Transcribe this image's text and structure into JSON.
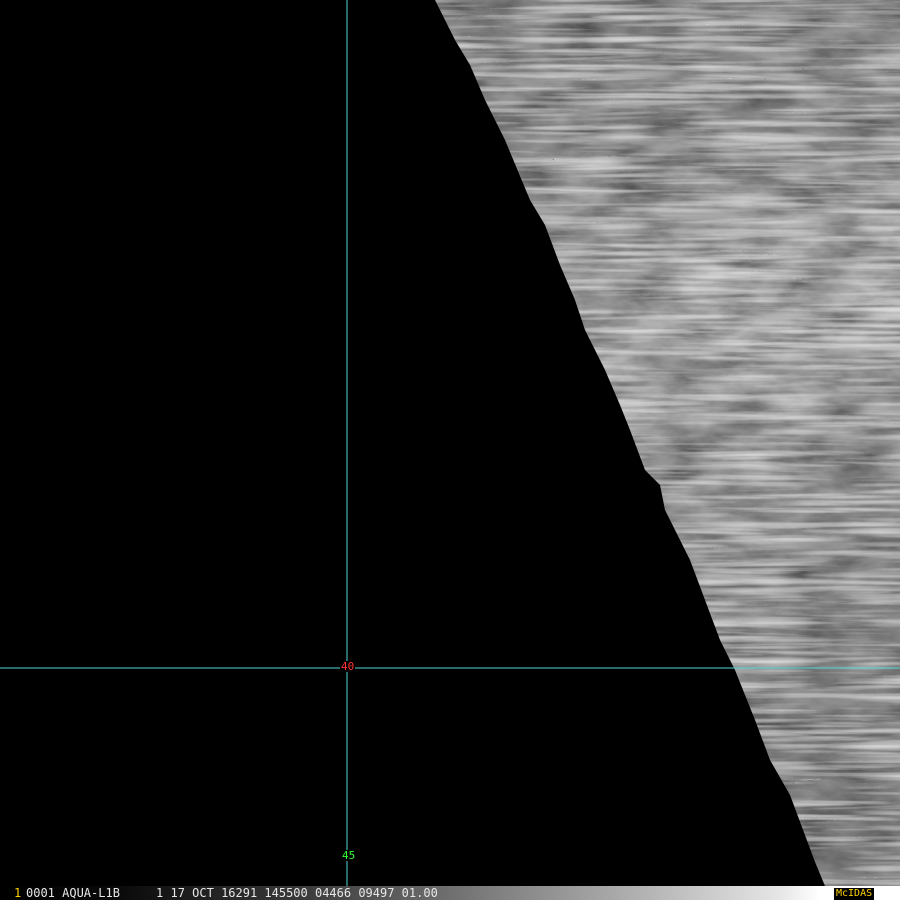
{
  "image": {
    "satellite_header": "0001 AQUA-L1B     1 17 OCT 16291 145500 04466 09497 01.00",
    "frame_number": "1",
    "brand": "McIDAS",
    "grid": {
      "lat_label": "40",
      "lon_label": "45"
    }
  },
  "colors": {
    "grid_line": "#4fd6d6",
    "lat_label": "#ff3333",
    "lon_label": "#33ff33",
    "frame_number": "#ffd200",
    "header_text": "#e8e8e8",
    "brand": "#ffd200",
    "cloud_base": "#9a9a9a"
  }
}
